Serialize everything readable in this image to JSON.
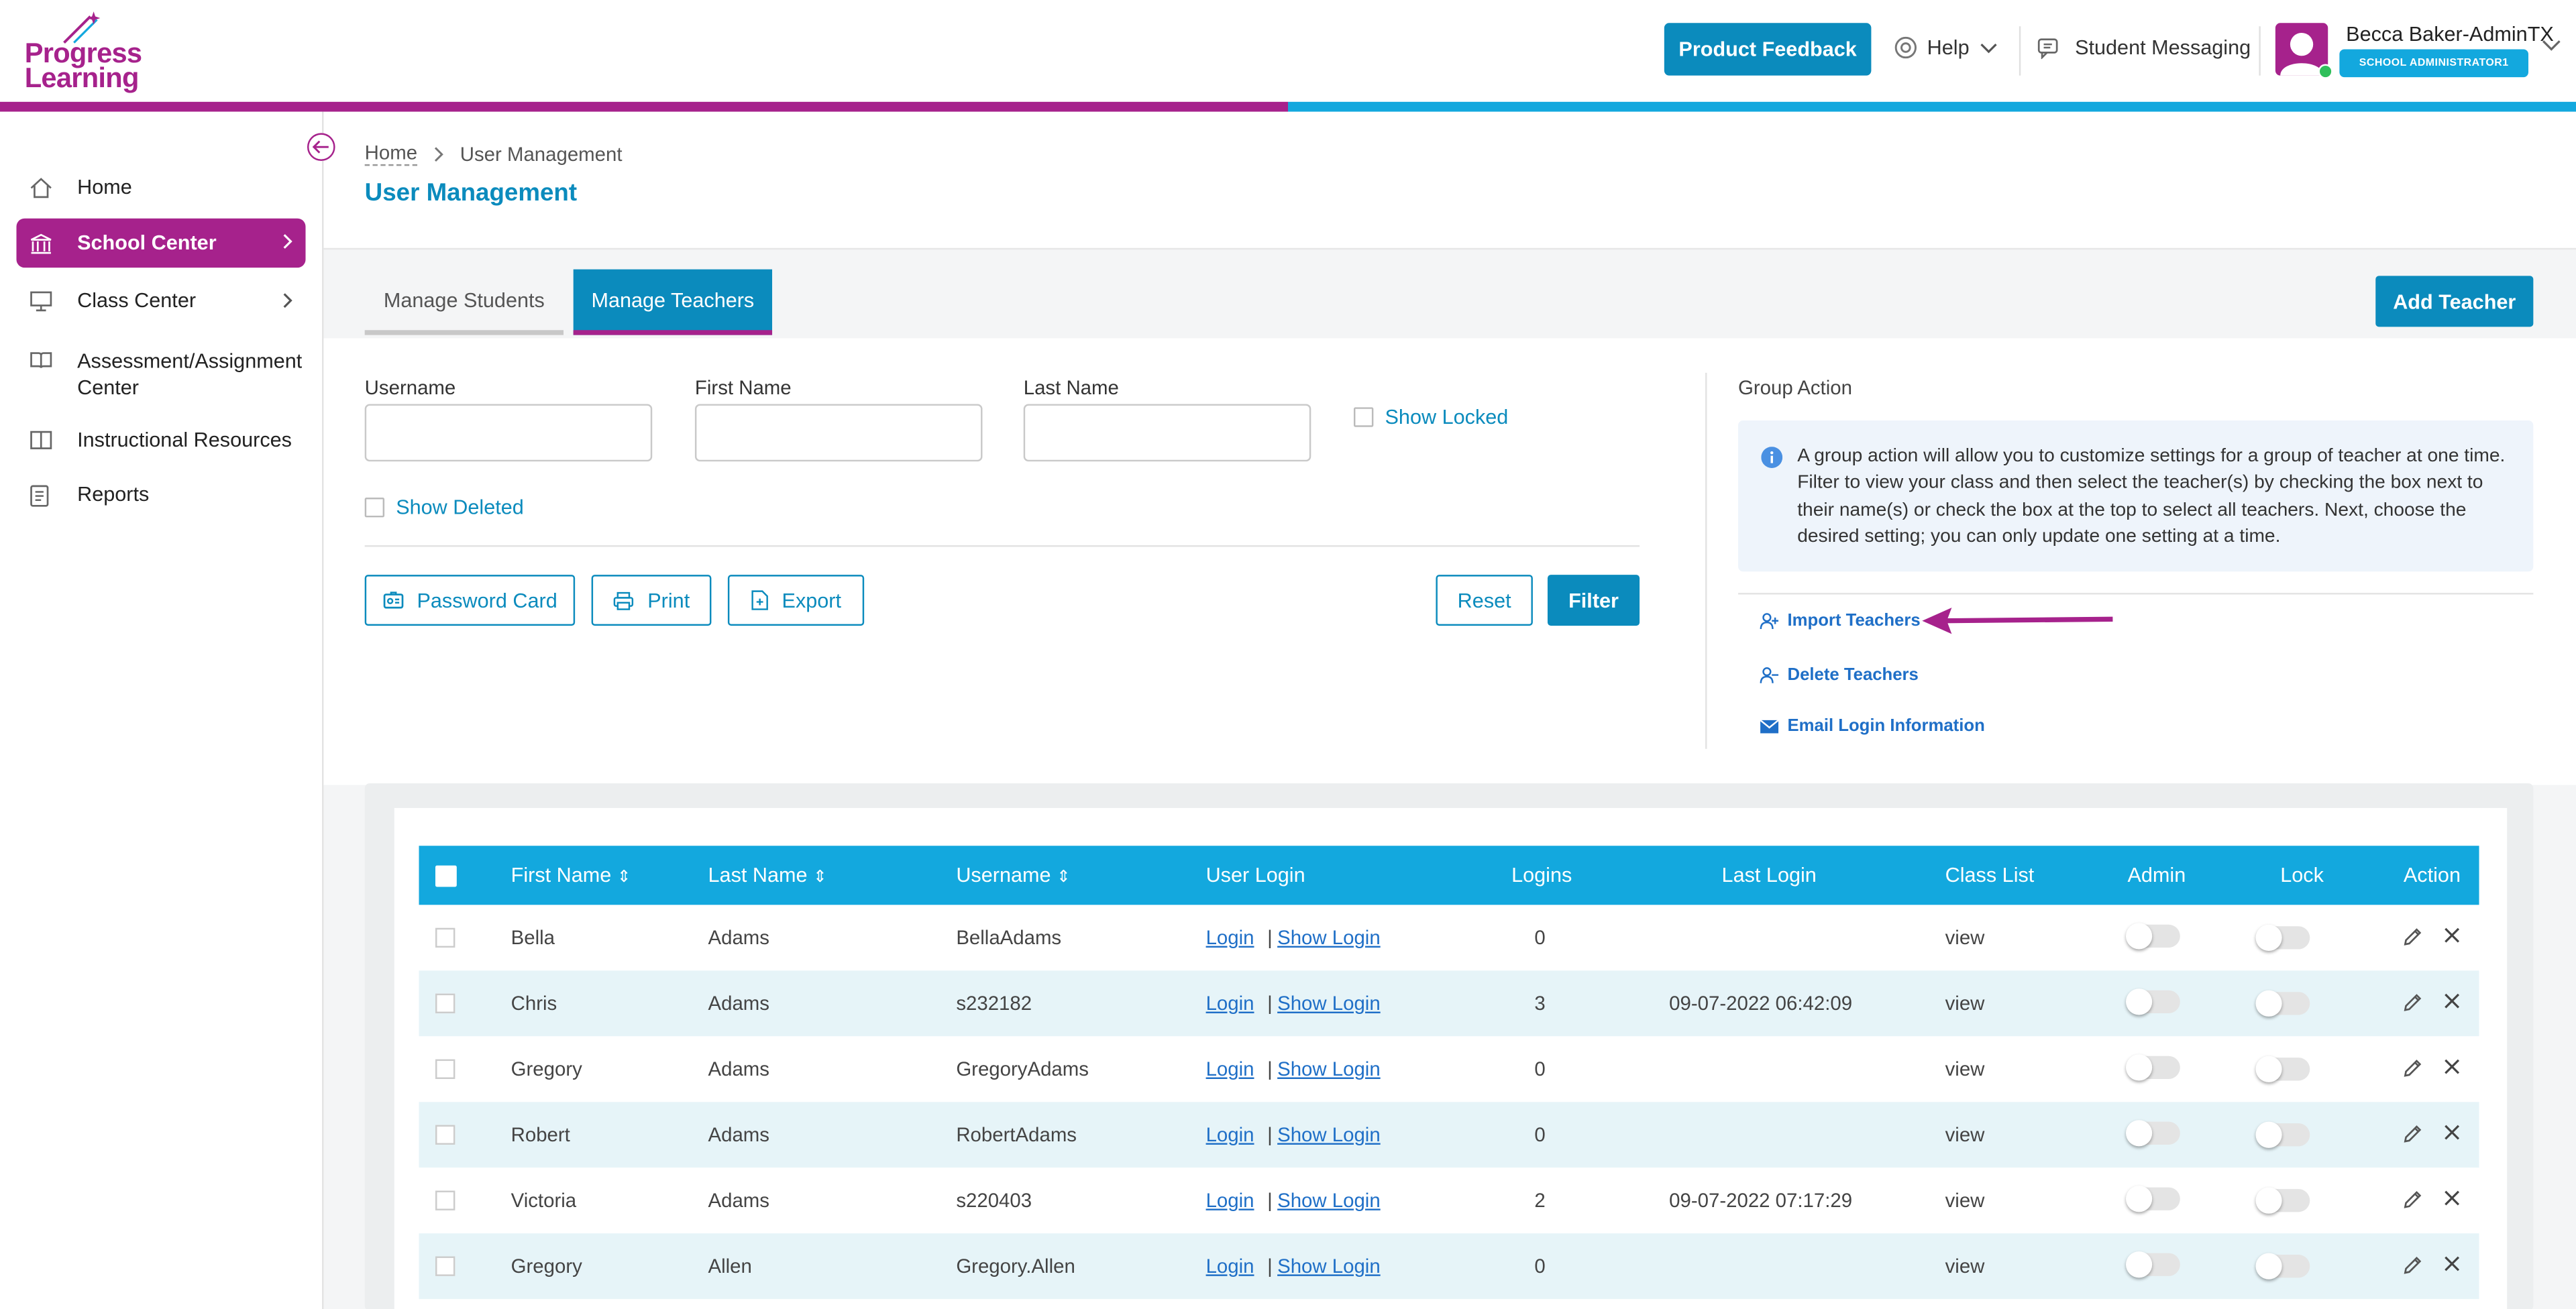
{
  "header": {
    "logo_line1": "Progress",
    "logo_line2": "Learning",
    "feedback_label": "Product Feedback",
    "help_label": "Help",
    "messaging_label": "Student Messaging",
    "user_name": "Becca Baker-AdminTX",
    "user_role": "SCHOOL ADMINISTRATOR1",
    "colors": {
      "brand_purple": "#a6228c",
      "brand_blue": "#13a8de",
      "button_blue": "#0b8bbd"
    }
  },
  "sidebar": {
    "items": [
      {
        "label": "Home",
        "icon": "home-icon"
      },
      {
        "label": "School Center",
        "icon": "school-icon",
        "active": true
      },
      {
        "label": "Class Center",
        "icon": "class-icon"
      },
      {
        "label": "Assessment/Assignment",
        "label2": "Center",
        "icon": "book-icon"
      },
      {
        "label": "Instructional Resources",
        "icon": "resources-icon"
      },
      {
        "label": "Reports",
        "icon": "reports-icon"
      }
    ]
  },
  "breadcrumb": {
    "home": "Home",
    "current": "User Management"
  },
  "page_title": "User Management",
  "tabs": {
    "students": "Manage Students",
    "teachers": "Manage Teachers",
    "active": "teachers"
  },
  "add_teacher_label": "Add Teacher",
  "filters": {
    "username_label": "Username",
    "username_value": "",
    "first_name_label": "First Name",
    "first_name_value": "",
    "last_name_label": "Last Name",
    "last_name_value": "",
    "show_locked_label": "Show Locked",
    "show_deleted_label": "Show Deleted"
  },
  "actions": {
    "password_card": "Password Card",
    "print": "Print",
    "export": "Export",
    "reset": "Reset",
    "filter": "Filter"
  },
  "group_action": {
    "title": "Group Action",
    "info": "A group action will allow you to customize settings for a group of teacher at one time. Filter to view your class and then select the teacher(s) by checking the box next to their name(s) or check the box at the top to select all teachers. Next, choose the desired setting; you can only update one setting at a time.",
    "import": "Import Teachers",
    "delete": "Delete Teachers",
    "email": "Email Login Information"
  },
  "table": {
    "columns": [
      "First Name",
      "Last Name",
      "Username",
      "User Login",
      "Logins",
      "Last Login",
      "Class List",
      "Admin",
      "Lock",
      "Action"
    ],
    "sort_glyph": "⇕",
    "login_link": "Login",
    "pipe": "|",
    "show_login_link": "Show Login",
    "rows": [
      {
        "first": "Bella",
        "last": "Adams",
        "username": "BellaAdams",
        "logins": "0",
        "last_login": "",
        "class_list": "view",
        "admin": false,
        "lock": false
      },
      {
        "first": "Chris",
        "last": "Adams",
        "username": "s232182",
        "logins": "3",
        "last_login": "09-07-2022 06:42:09",
        "class_list": "view",
        "admin": false,
        "lock": false
      },
      {
        "first": "Gregory",
        "last": "Adams",
        "username": "GregoryAdams",
        "logins": "0",
        "last_login": "",
        "class_list": "view",
        "admin": false,
        "lock": false
      },
      {
        "first": "Robert",
        "last": "Adams",
        "username": "RobertAdams",
        "logins": "0",
        "last_login": "",
        "class_list": "view",
        "admin": false,
        "lock": false
      },
      {
        "first": "Victoria",
        "last": "Adams",
        "username": "s220403",
        "logins": "2",
        "last_login": "09-07-2022 07:17:29",
        "class_list": "view",
        "admin": false,
        "lock": false
      },
      {
        "first": "Gregory",
        "last": "Allen",
        "username": "Gregory.Allen",
        "logins": "0",
        "last_login": "",
        "class_list": "view",
        "admin": false,
        "lock": false
      }
    ]
  }
}
